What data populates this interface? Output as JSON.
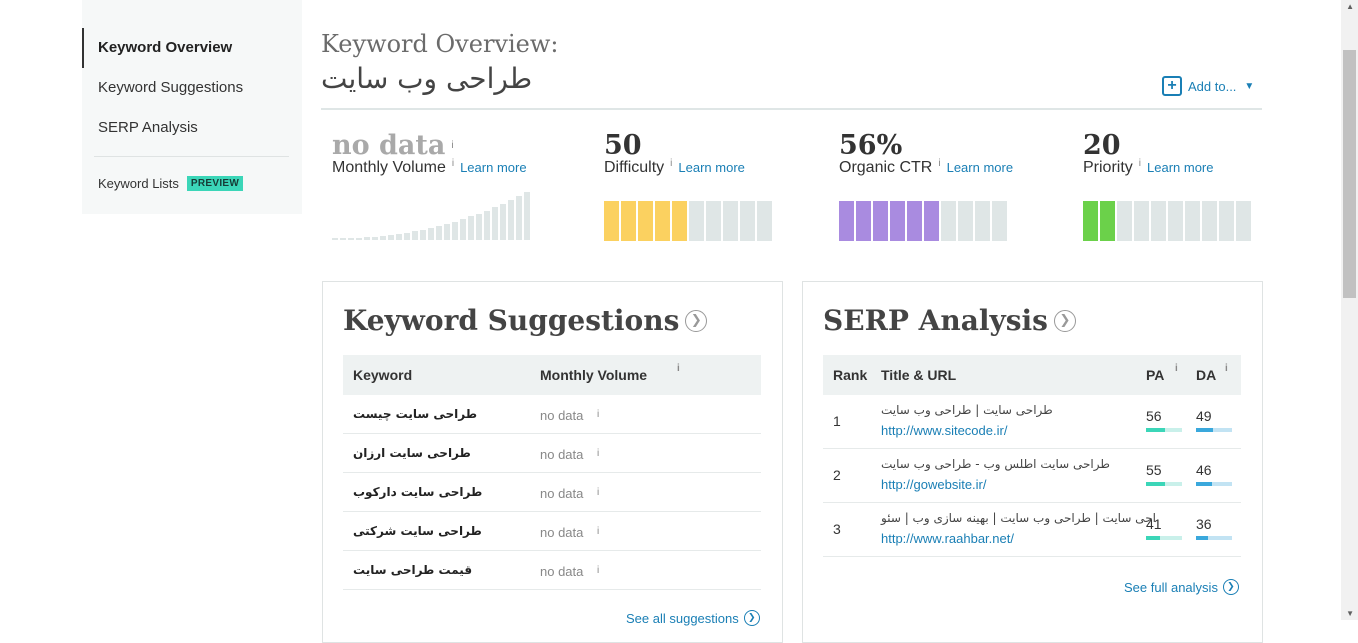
{
  "sidebar": {
    "items": [
      {
        "label": "Keyword Overview",
        "active": true
      },
      {
        "label": "Keyword Suggestions",
        "active": false
      },
      {
        "label": "SERP Analysis",
        "active": false
      }
    ],
    "lists_label": "Keyword Lists",
    "badge": "PREVIEW"
  },
  "header": {
    "label": "Keyword Overview:",
    "keyword": "طراحی وب سایت",
    "add_to": "Add to...",
    "add_icon": "plus-icon",
    "caret_icon": "caret-down-icon"
  },
  "metrics": {
    "volume": {
      "value": "no data",
      "label": "Monthly Volume",
      "info": "i",
      "learn": "Learn more"
    },
    "difficulty": {
      "value": "50",
      "label": "Difficulty",
      "info": "i",
      "learn": "Learn more",
      "segments": 10,
      "filled": 5,
      "color": "#fbd160"
    },
    "ctr": {
      "value": "56%",
      "label": "Organic CTR",
      "info": "i",
      "learn": "Learn more",
      "segments": 10,
      "filled": 6,
      "color": "#a98be0"
    },
    "priority": {
      "value": "20",
      "label": "Priority",
      "info": "i",
      "learn": "Learn more",
      "segments": 10,
      "filled": 2,
      "color": "#6bd14a"
    }
  },
  "suggestions": {
    "title": "Keyword Suggestions",
    "headers": {
      "keyword": "Keyword",
      "volume": "Monthly Volume",
      "info": "i"
    },
    "rows": [
      {
        "keyword": "طراحی سایت چیست",
        "volume": "no data"
      },
      {
        "keyword": "طراحی سایت ارزان",
        "volume": "no data"
      },
      {
        "keyword": "طراحی سایت دارکوب",
        "volume": "no data"
      },
      {
        "keyword": "طراحی سایت شرکتی",
        "volume": "no data"
      },
      {
        "keyword": "قیمت طراحی سایت",
        "volume": "no data"
      }
    ],
    "info": "i",
    "footer": "See all suggestions"
  },
  "serp": {
    "title": "SERP Analysis",
    "headers": {
      "rank": "Rank",
      "title": "Title & URL",
      "pa": "PA",
      "da": "DA",
      "info": "i"
    },
    "rows": [
      {
        "rank": "1",
        "title": "طراحی سایت | طراحی وب سایت",
        "url": "http://www.sitecode.ir/",
        "pa": "56",
        "da": "49"
      },
      {
        "rank": "2",
        "title": "طراحی سایت اطلس وب - طراحی وب سایت",
        "url": "http://gowebsite.ir/",
        "pa": "55",
        "da": "46"
      },
      {
        "rank": "3",
        "title": "اجی سایت | طراحی وب سایت | بهینه سازی وب | سئو",
        "url": "http://www.raahbar.net/",
        "pa": "41",
        "da": "36"
      }
    ],
    "footer": "See full analysis"
  },
  "colors": {
    "accent": "#1a7fb5",
    "pa": "#3bd6b8",
    "da": "#3aa8dc",
    "empty": "#dfe6e6"
  }
}
